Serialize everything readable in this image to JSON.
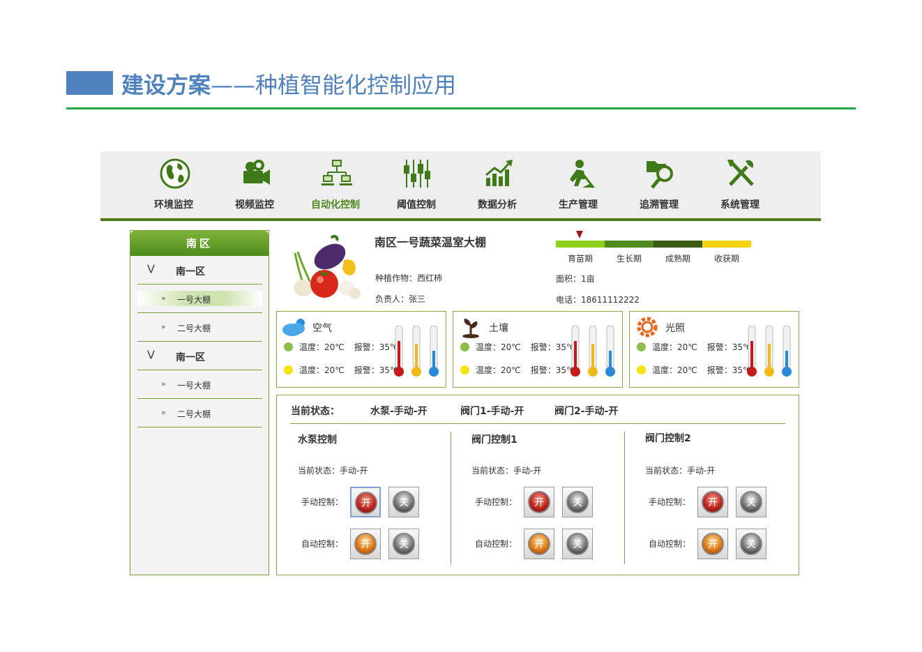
{
  "slide": {
    "title_bold": "建设方案",
    "title_rest": "——种植智能化控制应用",
    "accent_color": "#4f81bd",
    "rule_color": "#27a744"
  },
  "nav": {
    "items": [
      {
        "label": "环境监控",
        "icon": "globe-icon"
      },
      {
        "label": "视频监控",
        "icon": "camera-icon"
      },
      {
        "label": "自动化控制",
        "icon": "network-icon",
        "active": true
      },
      {
        "label": "阈值控制",
        "icon": "sliders-icon"
      },
      {
        "label": "数据分析",
        "icon": "chart-icon"
      },
      {
        "label": "生产管理",
        "icon": "worker-icon"
      },
      {
        "label": "追溯管理",
        "icon": "search-icon"
      },
      {
        "label": "系统管理",
        "icon": "tools-icon"
      }
    ],
    "active_color": "#4e8a1e"
  },
  "sidebar": {
    "header": "南区",
    "groups": [
      {
        "label": "南一区",
        "items": [
          "一号大棚",
          "二号大棚"
        ]
      },
      {
        "label": "南一区",
        "items": [
          "一号大棚",
          "二号大棚"
        ]
      }
    ]
  },
  "info": {
    "title": "南区一号蔬菜温室大棚",
    "crop": "种植作物：西红柿",
    "owner": "负责人：张三",
    "area": "面积：1亩",
    "phone": "电话：18611112222",
    "stages": [
      "育苗期",
      "生长期",
      "成熟期",
      "收获期"
    ],
    "stage_colors": [
      "#8ed11a",
      "#4e8a1e",
      "#3a5a12",
      "#f5d312"
    ],
    "current_stage": "育苗期"
  },
  "sensors": [
    {
      "name": "空气",
      "icon": "cloud-icon",
      "row1": {
        "temp": "温度：20℃",
        "alarm": "报警：35℃"
      },
      "row2": {
        "temp": "温度：20℃",
        "alarm": "报警：35℃"
      }
    },
    {
      "name": "土壤",
      "icon": "sprout-icon",
      "row1": {
        "temp": "温度：20℃",
        "alarm": "报警：35℃"
      },
      "row2": {
        "temp": "温度：20℃",
        "alarm": "报警：35℃"
      }
    },
    {
      "name": "光照",
      "icon": "sun-icon",
      "row1": {
        "temp": "温度：20℃",
        "alarm": "报警：35℃"
      },
      "row2": {
        "temp": "温度：20℃",
        "alarm": "报警：35℃"
      }
    }
  ],
  "control": {
    "status_label": "当前状态：",
    "statuses": [
      "水泵-手动-开",
      "阀门1-手动-开",
      "阀门2-手动-开"
    ],
    "columns": [
      {
        "title": "水泵控制",
        "state": "当前状态：手动-开",
        "manual_label": "手动控制：",
        "auto_label": "自动控制：",
        "on": "开",
        "off": "关"
      },
      {
        "title": "阀门控制1",
        "state": "当前状态：手动-开",
        "manual_label": "手动控制：",
        "auto_label": "自动控制：",
        "on": "开",
        "off": "关"
      },
      {
        "title": "阀门控制2",
        "state": "当前状态：手动-开",
        "manual_label": "手动控制：",
        "auto_label": "自动控制：",
        "on": "开",
        "off": "关"
      }
    ]
  }
}
